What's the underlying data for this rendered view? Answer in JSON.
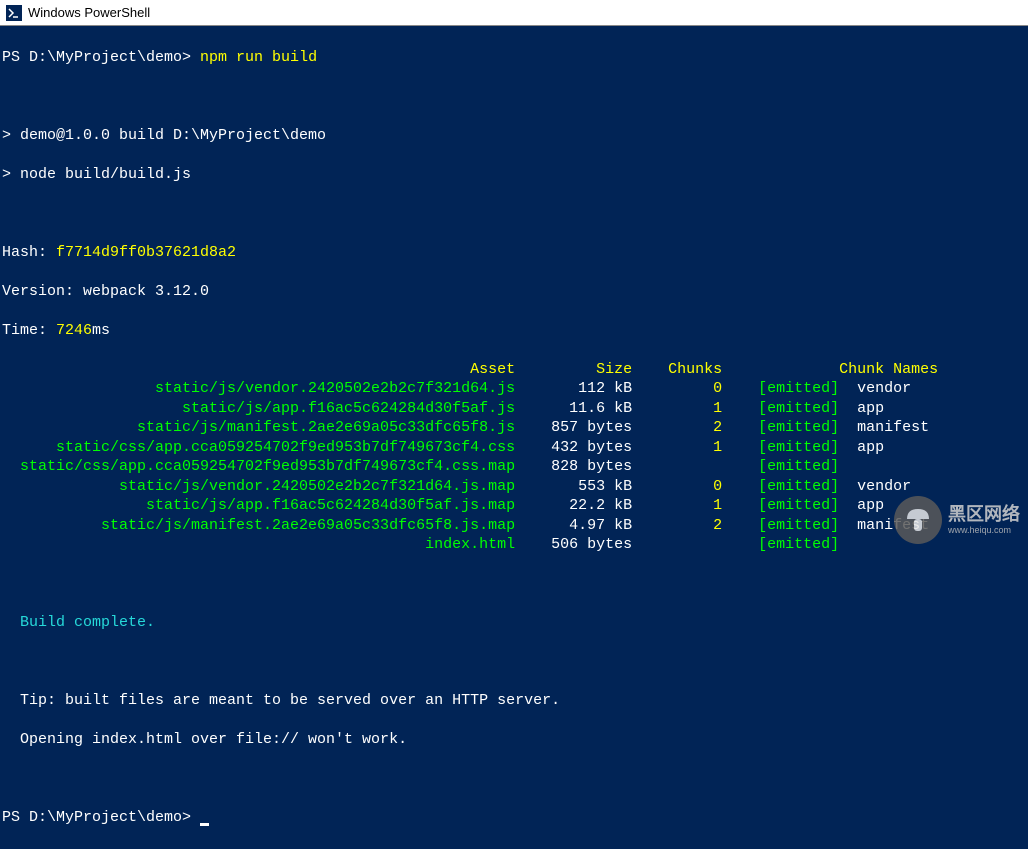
{
  "titlebar": {
    "title": "Windows PowerShell"
  },
  "prompt1": {
    "ps": "PS D:\\MyProject\\demo> ",
    "cmd": "npm run build"
  },
  "script": {
    "line1": "> demo@1.0.0 build D:\\MyProject\\demo",
    "line2": "> node build/build.js"
  },
  "hash": {
    "label": "Hash: ",
    "value": "f7714d9ff0b37621d8a2"
  },
  "version": {
    "label": "Version: webpack ",
    "value": "3.12.0"
  },
  "time": {
    "label": "Time: ",
    "value": "7246",
    "suffix": "ms"
  },
  "headers": {
    "asset": "Asset",
    "size": "Size",
    "chunks": "Chunks",
    "chunknames": "Chunk Names"
  },
  "rows": [
    {
      "asset": "static/js/vendor.2420502e2b2c7f321d64.js",
      "size": "112 kB",
      "chunks": "0",
      "emitted": "[emitted]",
      "name": "vendor"
    },
    {
      "asset": "static/js/app.f16ac5c624284d30f5af.js",
      "size": "11.6 kB",
      "chunks": "1",
      "emitted": "[emitted]",
      "name": "app"
    },
    {
      "asset": "static/js/manifest.2ae2e69a05c33dfc65f8.js",
      "size": "857 bytes",
      "chunks": "2",
      "emitted": "[emitted]",
      "name": "manifest"
    },
    {
      "asset": "static/css/app.cca059254702f9ed953b7df749673cf4.css",
      "size": "432 bytes",
      "chunks": "1",
      "emitted": "[emitted]",
      "name": "app"
    },
    {
      "asset": "static/css/app.cca059254702f9ed953b7df749673cf4.css.map",
      "size": "828 bytes",
      "chunks": "",
      "emitted": "[emitted]",
      "name": ""
    },
    {
      "asset": "static/js/vendor.2420502e2b2c7f321d64.js.map",
      "size": "553 kB",
      "chunks": "0",
      "emitted": "[emitted]",
      "name": "vendor"
    },
    {
      "asset": "static/js/app.f16ac5c624284d30f5af.js.map",
      "size": "22.2 kB",
      "chunks": "1",
      "emitted": "[emitted]",
      "name": "app"
    },
    {
      "asset": "static/js/manifest.2ae2e69a05c33dfc65f8.js.map",
      "size": "4.97 kB",
      "chunks": "2",
      "emitted": "[emitted]",
      "name": "manifest"
    },
    {
      "asset": "index.html",
      "size": "506 bytes",
      "chunks": "",
      "emitted": "[emitted]",
      "name": ""
    }
  ],
  "build_complete": "Build complete.",
  "tip1": "  Tip: built files are meant to be served over an HTTP server.",
  "tip2": "  Opening index.html over file:// won't work.",
  "prompt2": {
    "ps": "PS D:\\MyProject\\demo> "
  },
  "watermark": {
    "text": "黑区网络",
    "sub": "www.heiqu.com"
  }
}
